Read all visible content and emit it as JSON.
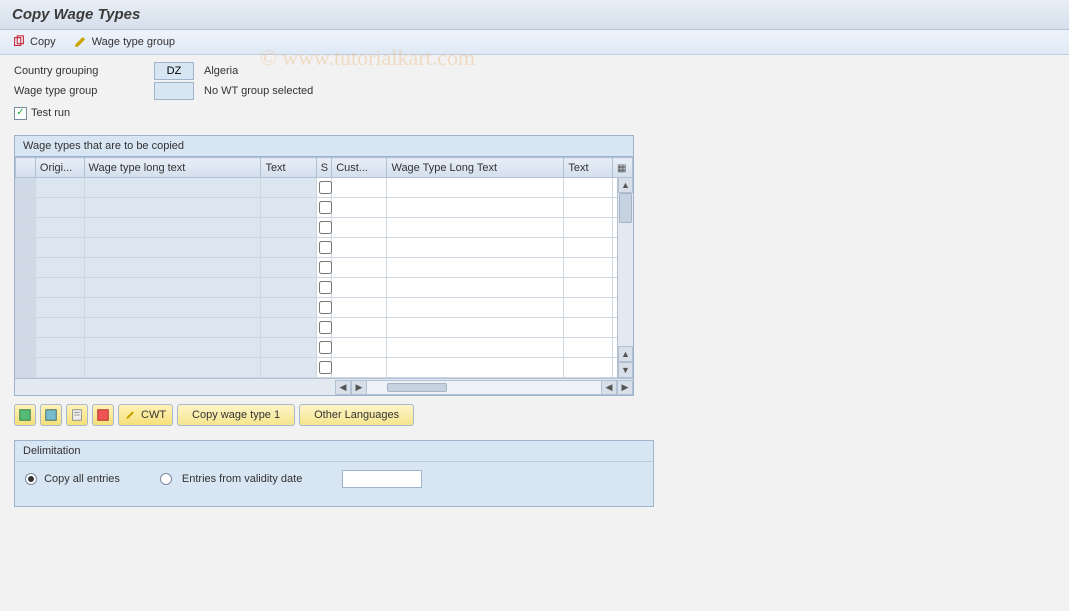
{
  "title": "Copy Wage Types",
  "toolbar": {
    "copy_label": "Copy",
    "wtg_label": "Wage type group"
  },
  "form": {
    "country_label": "Country grouping",
    "country_code": "DZ",
    "country_desc": "Algeria",
    "wtg_label": "Wage type group",
    "wtg_value": "",
    "wtg_desc": "No WT group selected",
    "testrun_label": "Test run",
    "testrun_checked": true
  },
  "panel_title": "Wage types that are to be copied",
  "columns": {
    "origi": "Origi...",
    "wtlt": "Wage type long text",
    "text1": "Text",
    "s": "S",
    "cust": "Cust...",
    "wtlt2": "Wage Type Long Text",
    "text2": "Text"
  },
  "actions": {
    "cwt": "CWT",
    "copy1": "Copy wage type 1",
    "other_lang": "Other Languages"
  },
  "delim": {
    "title": "Delimitation",
    "opt_all": "Copy all entries",
    "opt_from": "Entries from validity date",
    "selected": "all",
    "date": ""
  },
  "watermark": "© www.tutorialkart.com"
}
